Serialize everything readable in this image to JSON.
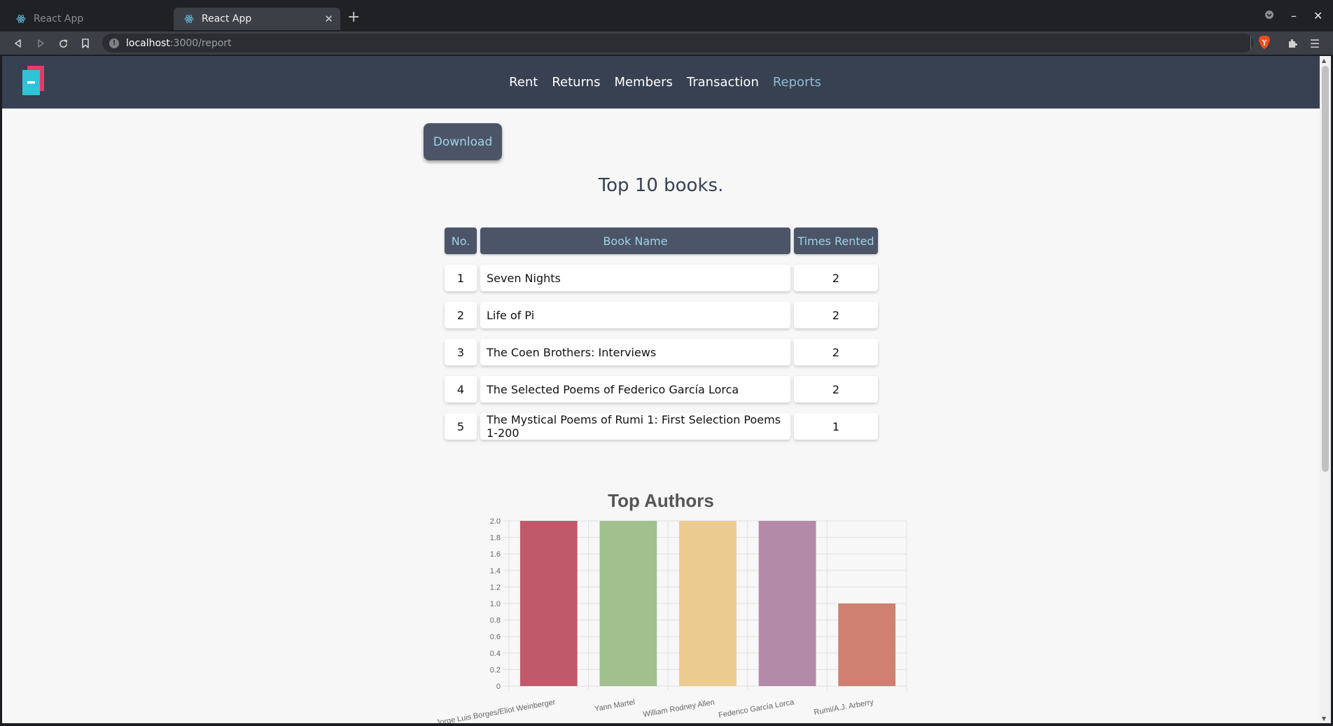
{
  "browser": {
    "tabs": [
      {
        "title": "React App",
        "active": false
      },
      {
        "title": "React App",
        "active": true
      }
    ],
    "url_host": "localhost",
    "url_path": ":3000/report"
  },
  "nav": {
    "items": [
      {
        "label": "Rent",
        "active": false
      },
      {
        "label": "Returns",
        "active": false
      },
      {
        "label": "Members",
        "active": false
      },
      {
        "label": "Transaction",
        "active": false
      },
      {
        "label": "Reports",
        "active": true
      }
    ]
  },
  "actions": {
    "download_label": "Download"
  },
  "report": {
    "title": "Top 10 books.",
    "columns": [
      "No.",
      "Book Name",
      "Times Rented"
    ],
    "rows": [
      {
        "no": "1",
        "name": "Seven Nights",
        "times": "2"
      },
      {
        "no": "2",
        "name": "Life of Pi",
        "times": "2"
      },
      {
        "no": "3",
        "name": "The Coen Brothers: Interviews",
        "times": "2"
      },
      {
        "no": "4",
        "name": "The Selected Poems of Federico García Lorca",
        "times": "2"
      },
      {
        "no": "5",
        "name": "The Mystical Poems of Rumi 1: First Selection Poems 1-200",
        "times": "1"
      }
    ]
  },
  "chart_data": {
    "type": "bar",
    "title": "Top Authors",
    "categories": [
      "Jorge Luis Borges/Eliot Weinberger",
      "Yann Martel",
      "William Rodney Allen",
      "Federico García Lorca",
      "Rumi/A.J. Arberry"
    ],
    "values": [
      2,
      2,
      2,
      2,
      1
    ],
    "colors": [
      "#c05a6b",
      "#a2bf8e",
      "#ebcb8f",
      "#b48aa9",
      "#d08070"
    ],
    "ylim": [
      0,
      2.0
    ],
    "yticks": [
      "0",
      "0.2",
      "0.4",
      "0.6",
      "0.8",
      "1.0",
      "1.2",
      "1.4",
      "1.6",
      "1.8",
      "2.0"
    ],
    "grid": true,
    "legend": "none"
  }
}
